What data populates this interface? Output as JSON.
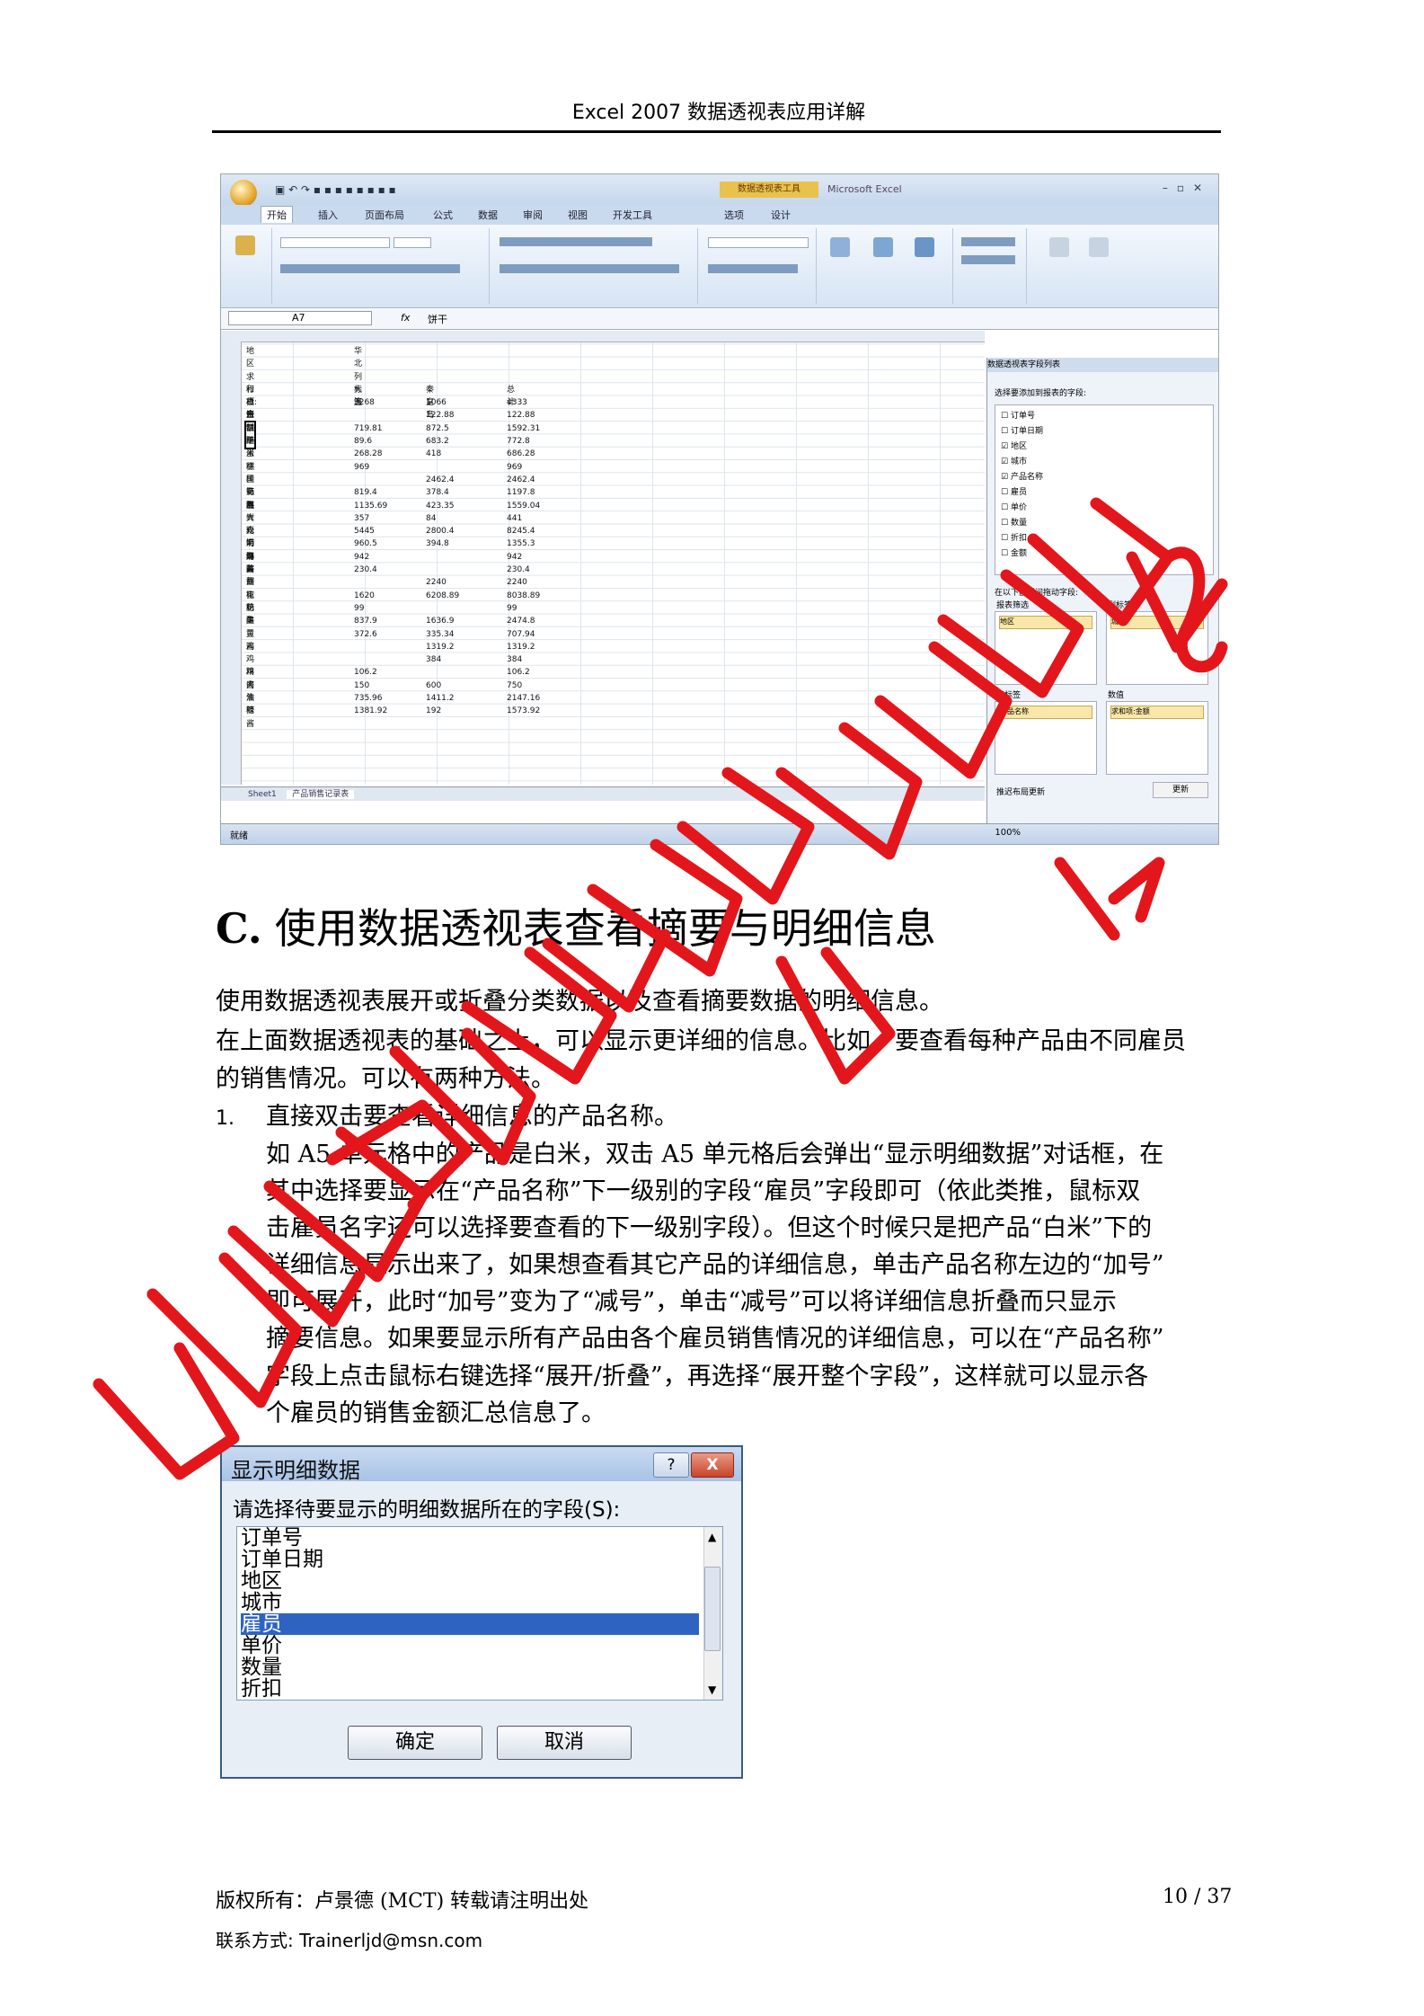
{
  "header": {
    "title": "Excel 2007  数据透视表应用详解"
  },
  "excel_screenshot": {
    "app_title": "Microsoft Excel",
    "name_box": "A7",
    "formula_value": "饼干",
    "tabs": [
      "开始",
      "插入",
      "页面布局",
      "公式",
      "数据",
      "审阅",
      "视图",
      "开发工具",
      "选项",
      "设计"
    ],
    "contextual_tab": "数据透视表工具",
    "pivot_rows": [
      [
        "地区",
        "华北",
        ""
      ],
      [
        "",
        "",
        ""
      ],
      [
        "求和项:金额",
        "列标签",
        ""
      ],
      [
        "行标签",
        "大连",
        "秦皇岛",
        "总计"
      ],
      [
        "白米",
        "3268",
        "1066",
        "4333"
      ],
      [
        "白绒酪",
        "",
        "122.88",
        "122.88"
      ],
      [
        "饼干",
        "719.81",
        "872.5",
        "1592.31"
      ],
      [
        "糙米",
        "89.6",
        "683.2",
        "772.8"
      ],
      [
        "蛋糕",
        "268.28",
        "418",
        "686.28"
      ],
      [
        "德国奶酪",
        "969",
        "",
        "969"
      ],
      [
        "桂花糕",
        "",
        "2462.4",
        "2462.4"
      ],
      [
        "海苔",
        "819.4",
        "378.4",
        "1197.8"
      ],
      [
        "海鲜粉",
        "1135.69",
        "423.35",
        "1559.04"
      ],
      [
        "大众奶酪",
        "357",
        "84",
        "441"
      ],
      [
        "光明奶酪",
        "5445",
        "2800.4",
        "8245.4"
      ],
      [
        "海鲜酱",
        "960.5",
        "394.8",
        "1355.3"
      ],
      [
        "海苔酱",
        "942",
        "",
        "942"
      ],
      [
        "黄豆",
        "230.4",
        "",
        "230.4"
      ],
      [
        "胡椒粉",
        "",
        "2240",
        "2240"
      ],
      [
        "花奶酪",
        "1620",
        "6208.89",
        "8038.89"
      ],
      [
        "花生",
        "99",
        "",
        "99"
      ],
      [
        "黄豆",
        "837.9",
        "1636.9",
        "2474.8"
      ],
      [
        "黄酱",
        "372.6",
        "335.34",
        "707.94"
      ],
      [
        "鸡",
        "",
        "1319.2",
        "1319.2"
      ],
      [
        "鸡精",
        "",
        "384",
        "384"
      ],
      [
        "鸡肉",
        "106.2",
        "",
        "106.2"
      ],
      [
        "酱油",
        "150",
        "600",
        "750"
      ],
      [
        "焦糖酱",
        "735.96",
        "1411.2",
        "2147.16"
      ],
      [
        "辣",
        "1381.92",
        "192",
        "1573.92"
      ]
    ],
    "sheet_tabs": [
      "Sheet1",
      "产品销售记录表"
    ],
    "status_text": "就绪",
    "zoom": "100%",
    "field_pane": {
      "title": "数据透视表字段列表",
      "choose_label": "选择要添加到报表的字段:",
      "fields": [
        "订单号",
        "订单日期",
        "地区",
        "城市",
        "产品名称",
        "雇员",
        "单价",
        "数量",
        "折扣",
        "金额"
      ],
      "drag_label": "在以下区域间拖动字段:",
      "report_filter": "报表筛选",
      "column_labels": "列标签",
      "row_labels": "行标签",
      "values": "数值",
      "filter_chip": "地区",
      "column_chip": "城市",
      "row_chip": "产品名称",
      "value_chip": "求和项:金额",
      "defer_label": "推迟布局更新",
      "update_button": "更新"
    }
  },
  "section": {
    "letter": "C.",
    "title": "使用数据透视表查看摘要与明细信息"
  },
  "intro": [
    "使用数据透视表展开或折叠分类数据以及查看摘要数据的明细信息。",
    "在上面数据透视表的基础之上，可以显示更详细的信息。比如，要查看每种产品由不同雇员",
    "的销售情况。可以有两种方法。"
  ],
  "list": {
    "number": "1.",
    "first_line": "直接双击要查看详细信息的产品名称。",
    "body": [
      "如  A5  单元格中的产品是白米，双击  A5  单元格后会弹出“显示明细数据”对话框，在",
      "其中选择要显示在“产品名称”下一级别的字段“雇员”字段即可（依此类推，鼠标双",
      "击雇员名字还可以选择要查看的下一级别字段）。但这个时候只是把产品“白米”下的",
      "详细信息显示出来了，如果想查看其它产品的详细信息，单击产品名称左边的“加号”",
      "即可展开，此时“加号”变为了“减号”，单击“减号”可以将详细信息折叠而只显示",
      "摘要信息。如果要显示所有产品由各个雇员销售情况的详细信息，可以在“产品名称”",
      "字段上点击鼠标右键选择“展开/折叠”，再选择“展开整个字段”，这样就可以显示各",
      "个雇员的销售金额汇总信息了。"
    ]
  },
  "dialog": {
    "title": "显示明细数据",
    "help_label": "?",
    "close_label": "X",
    "prompt": "请选择待要显示的明细数据所在的字段(S):",
    "items": [
      "订单号",
      "订单日期",
      "地区",
      "城市",
      "雇员",
      "单价",
      "数量",
      "折扣"
    ],
    "selected_item": "雇员",
    "ok_label": "确定",
    "cancel_label": "取消"
  },
  "footer": {
    "copyright": "版权所有：卢景德    (MCT)    转载请注明出处",
    "page": "10 / 37",
    "contact": "联系方式: Trainerljd@msn.com"
  },
  "colors": {
    "watermark": "#e3161c",
    "dialog_selection": "#2e63c2",
    "rule": "#000000"
  }
}
